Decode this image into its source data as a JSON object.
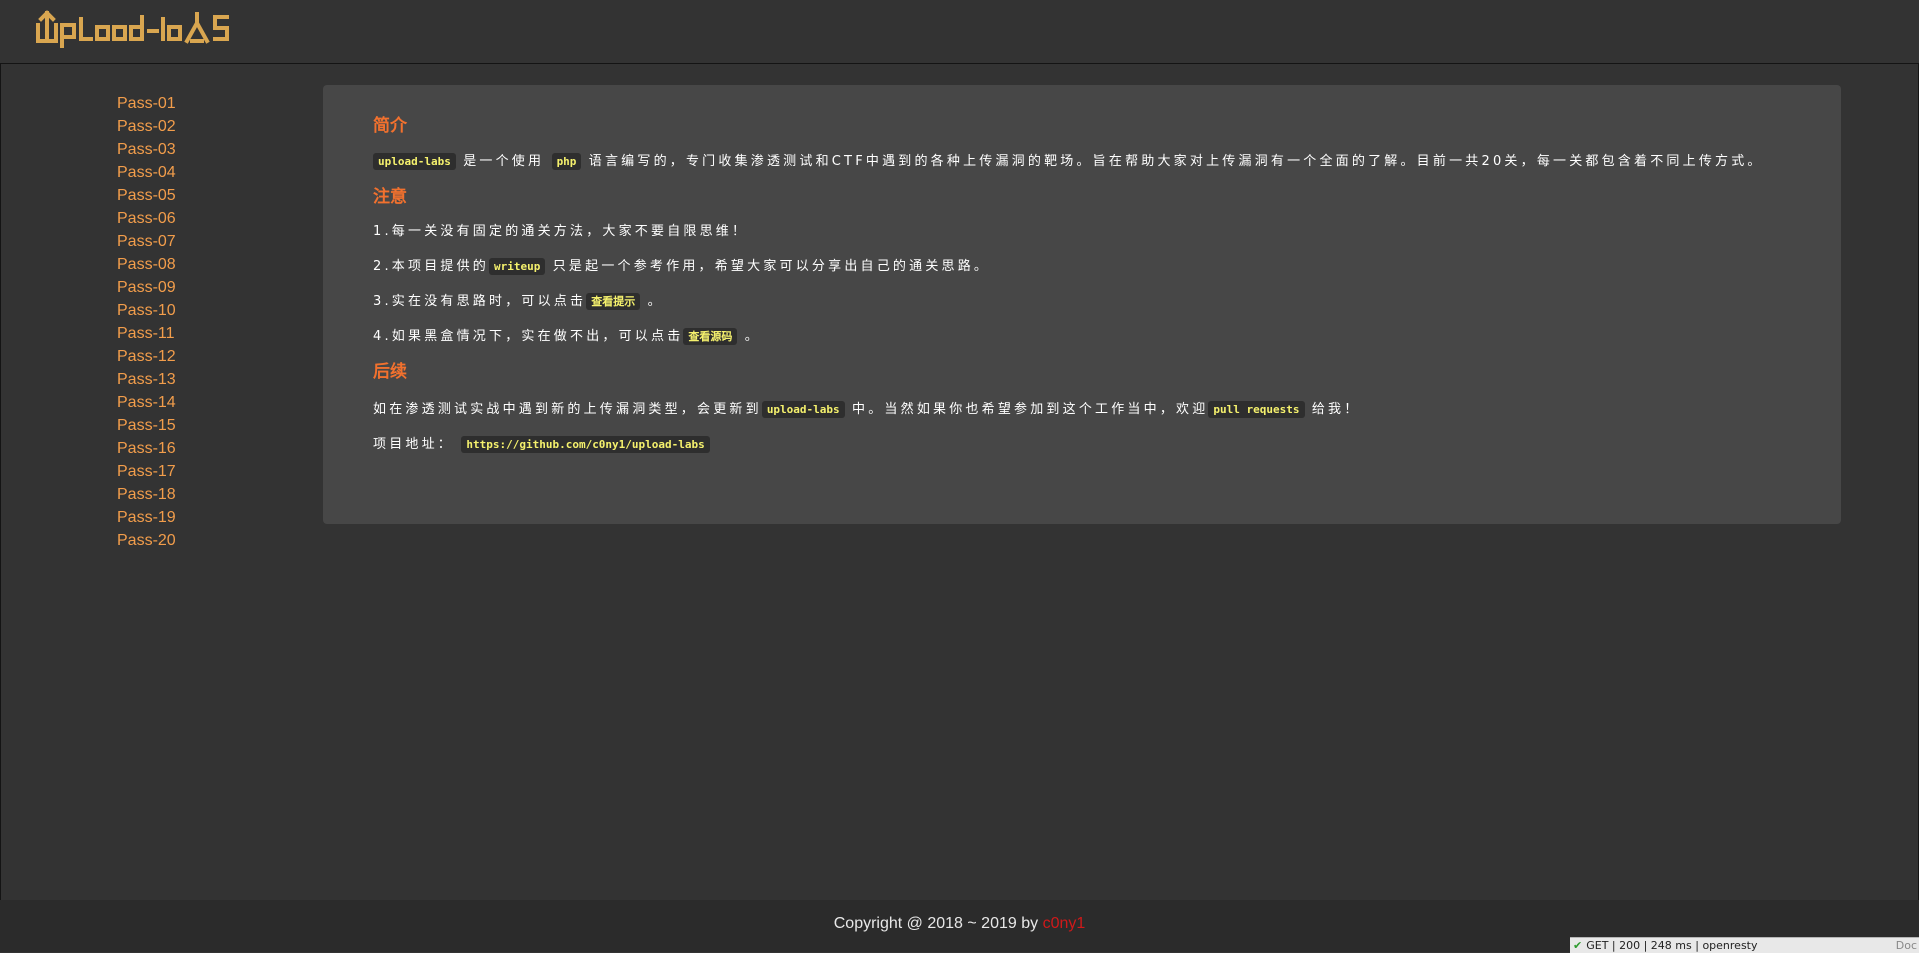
{
  "header": {
    "logo_text": "UploadLabs"
  },
  "sidebar": {
    "items": [
      "Pass-01",
      "Pass-02",
      "Pass-03",
      "Pass-04",
      "Pass-05",
      "Pass-06",
      "Pass-07",
      "Pass-08",
      "Pass-09",
      "Pass-10",
      "Pass-11",
      "Pass-12",
      "Pass-13",
      "Pass-14",
      "Pass-15",
      "Pass-16",
      "Pass-17",
      "Pass-18",
      "Pass-19",
      "Pass-20"
    ]
  },
  "intro": {
    "heading": "简介",
    "code_name": "upload-labs",
    "text_1": "是一个使用",
    "code_php": "php",
    "text_2": "语言编写的，专门收集渗透测试和CTF中遇到的各种上传漏洞的靶场。旨在帮助大家对上传漏洞有一个全面的了解。目前一共20关，每一关都包含着不同上传方式。"
  },
  "notes": {
    "heading": "注意",
    "item1": "1.每一关没有固定的通关方法，大家不要自限思维！",
    "item2_a": "2.本项目提供的",
    "item2_code": "writeup",
    "item2_b": "只是起一个参考作用，希望大家可以分享出自己的通关思路。",
    "item3_a": "3.实在没有思路时，可以点击",
    "item3_link": "查看提示",
    "item3_b": "。",
    "item4_a": "4.如果黑盒情况下，实在做不出，可以点击",
    "item4_link": "查看源码",
    "item4_b": "。"
  },
  "followup": {
    "heading": "后续",
    "text_a": "如在渗透测试实战中遇到新的上传漏洞类型，会更新到",
    "code_name": "upload-labs",
    "text_b": "中。当然如果你也希望参加到这个工作当中，欢迎",
    "code_pr": "pull requests",
    "text_c": "给我！",
    "addr_label": "项目地址：",
    "addr_url": "https://github.com/c0ny1/upload-labs"
  },
  "footer": {
    "copyright": "Copyright @ 2018 ~ 2019 by ",
    "author": "c0ny1"
  },
  "statusbar": {
    "text": "GET | 200 | 248 ms | openresty",
    "doc": "Doc"
  },
  "colors": {
    "accent_link": "#f29d4b",
    "heading": "#f2712e",
    "code": "#f5f16d",
    "author": "#d0191a"
  }
}
